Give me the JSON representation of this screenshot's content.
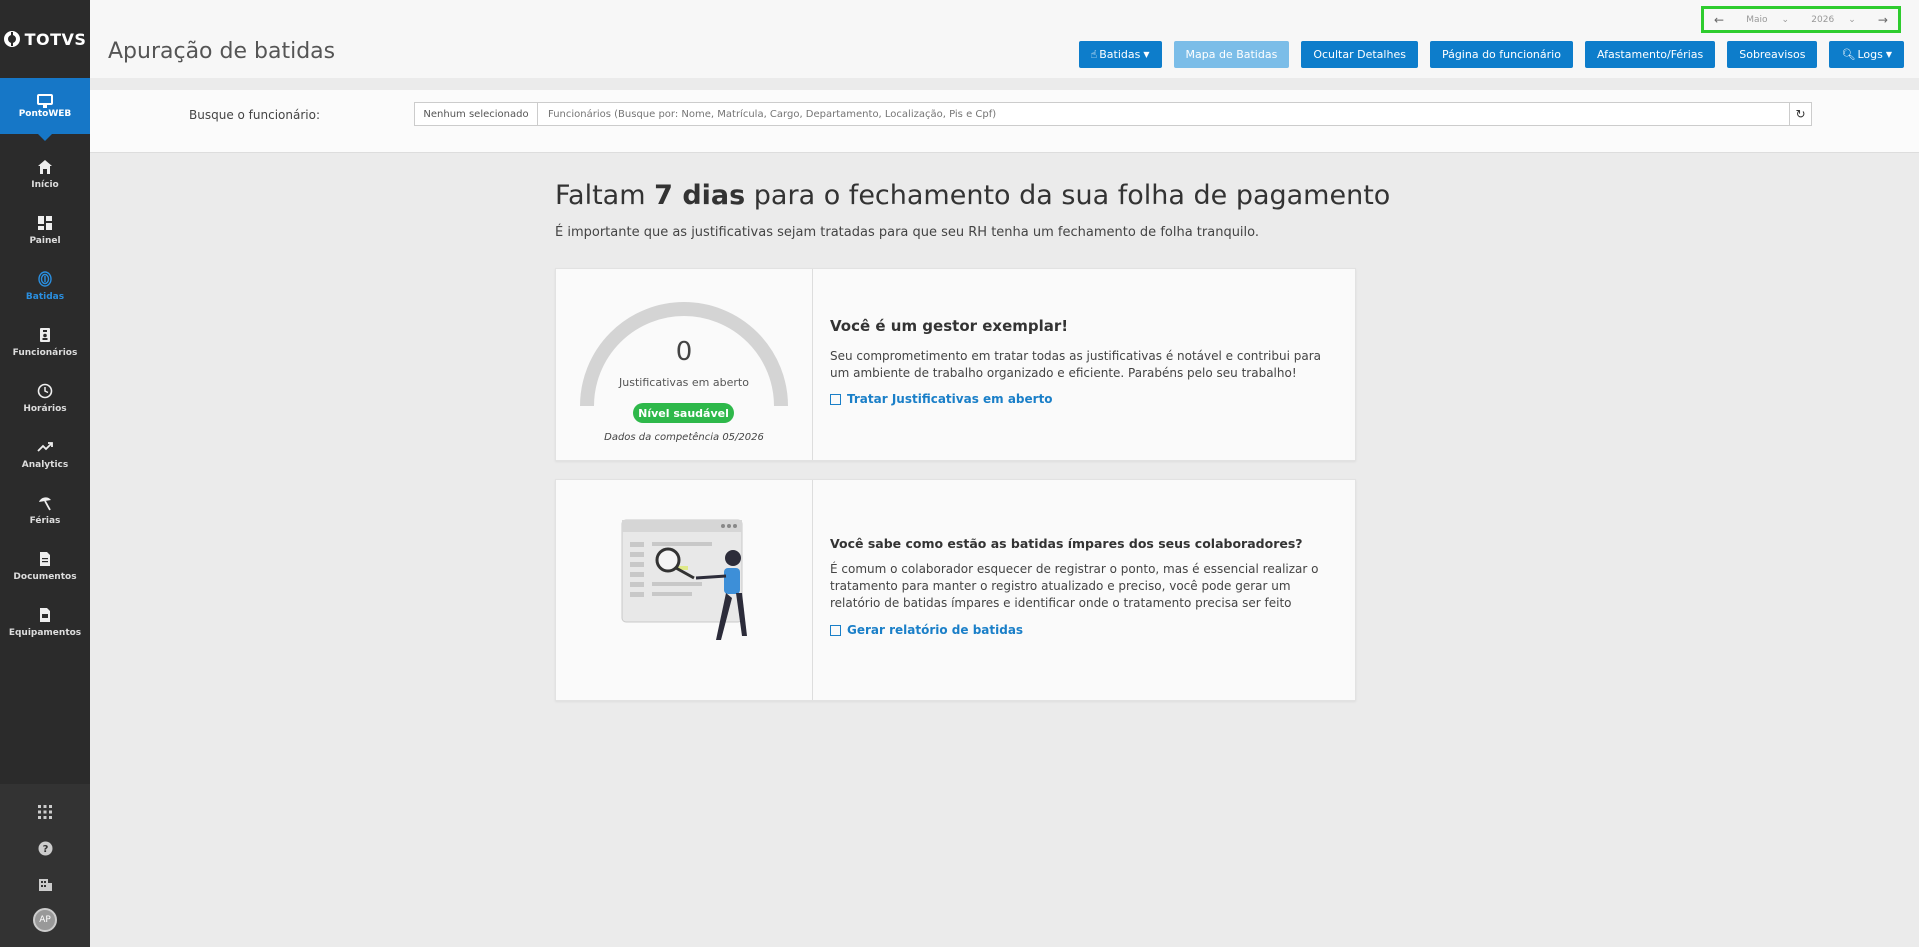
{
  "app": {
    "logo": "TOTVS"
  },
  "sidebar": {
    "active": {
      "label": "PontoWEB",
      "icon": "monitor-icon"
    },
    "items": [
      {
        "label": "Início",
        "icon": "home-icon"
      },
      {
        "label": "Painel",
        "icon": "dashboard-icon"
      },
      {
        "label": "Batidas",
        "icon": "fingerprint-icon",
        "current": true
      },
      {
        "label": "Funcionários",
        "icon": "badge-icon"
      },
      {
        "label": "Horários",
        "icon": "clock-icon"
      },
      {
        "label": "Analytics",
        "icon": "trend-icon"
      },
      {
        "label": "Férias",
        "icon": "beach-umbrella-icon"
      },
      {
        "label": "Documentos",
        "icon": "document-icon"
      },
      {
        "label": "Equipamentos",
        "icon": "equipment-icon"
      }
    ],
    "bottom": {
      "avatar": "AP"
    }
  },
  "header": {
    "title": "Apuração de batidas",
    "period": {
      "month": "Maio",
      "year": "2026"
    },
    "buttons": {
      "batidas": "Batidas",
      "mapa": "Mapa de Batidas",
      "ocultar": "Ocultar Detalhes",
      "pagina": "Página do funcionário",
      "afastamento": "Afastamento/Férias",
      "sobreavisos": "Sobreavisos",
      "logs": "Logs"
    }
  },
  "search": {
    "label": "Busque o funcionário:",
    "selected": "Nenhum selecionado",
    "placeholder": "Funcionários (Busque por: Nome, Matrícula, Cargo, Departamento, Localização, Pis e Cpf)"
  },
  "main": {
    "headline_pre": "Faltam",
    "headline_bold": "7 dias",
    "headline_post": "para o fechamento da sua folha de pagamento",
    "subhead": "É importante que as justificativas sejam tratadas para que seu RH tenha um fechamento de folha tranquilo.",
    "card1": {
      "gauge_value": "0",
      "gauge_caption": "Justificativas em aberto",
      "badge": "Nível saudável",
      "footer": "Dados da competência 05/2026",
      "title": "Você é um gestor exemplar!",
      "text": "Seu comprometimento em tratar todas as justificativas é notável e contribui para um ambiente de trabalho organizado e eficiente. Parabéns pelo seu trabalho!",
      "link": "Tratar Justificativas em aberto"
    },
    "card2": {
      "title": "Você sabe como estão as batidas ímpares dos seus colaboradores?",
      "text": "É comum o colaborador esquecer de registrar o ponto, mas é essencial realizar o tratamento para manter o registro atualizado e preciso, você pode gerar um relatório de batidas ímpares e identificar onde o tratamento precisa ser feito",
      "link": "Gerar relatório de batidas"
    }
  },
  "colors": {
    "primary": "#0d7dcb",
    "sidebar": "#2b2b2b",
    "healthy": "#2eb84a",
    "highlight": "#2ecc2e"
  }
}
